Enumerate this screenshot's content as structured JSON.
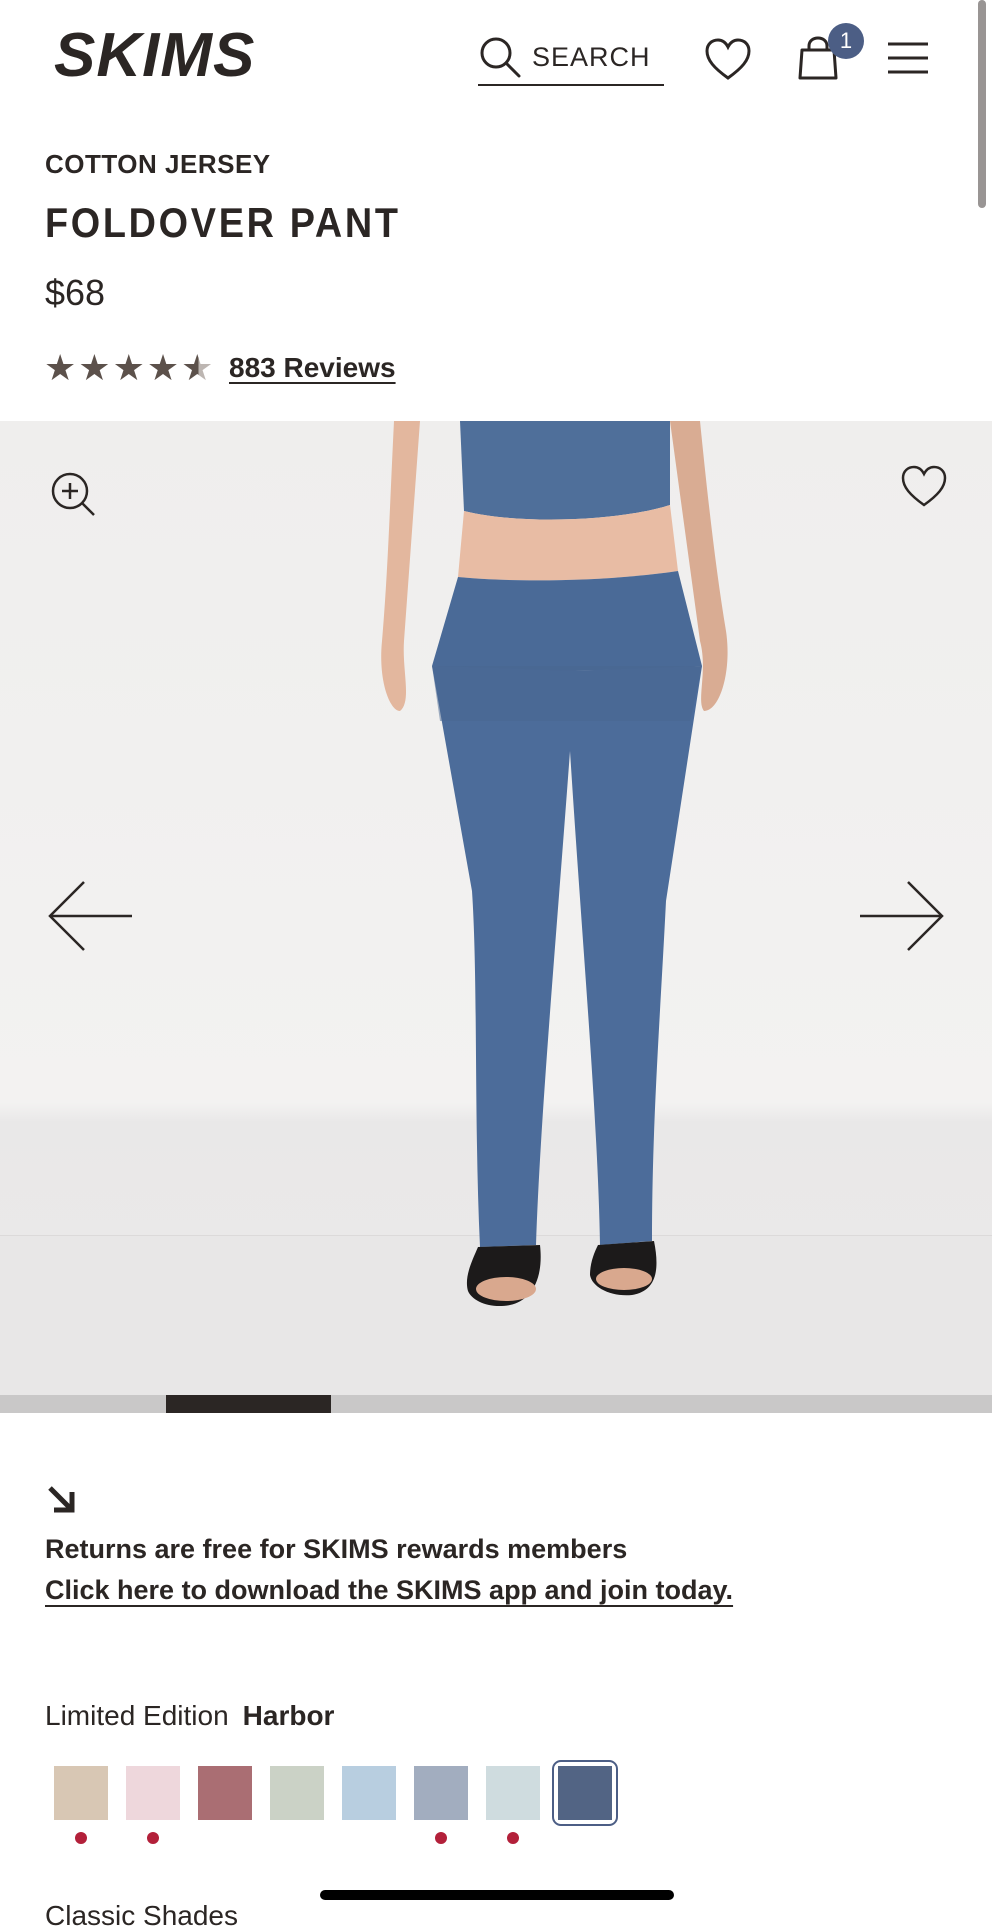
{
  "header": {
    "brand": "SKIMS",
    "search_label": "SEARCH",
    "bag_count": "1"
  },
  "product": {
    "collection": "COTTON JERSEY",
    "title": "FOLDOVER PANT",
    "price": "$68",
    "rating": 4.5,
    "reviews_label": "883 Reviews"
  },
  "gallery": {
    "progress": 0.167,
    "progress_start": 0.167
  },
  "returns": {
    "text": "Returns are free for SKIMS rewards members",
    "link": "Click here to download the SKIMS app and join today."
  },
  "color": {
    "edition_label": "Limited Edition",
    "selected_name": "Harbor",
    "swatches": [
      {
        "color": "#d8c7b4",
        "dot": true
      },
      {
        "color": "#eed7dc",
        "dot": true
      },
      {
        "color": "#aa6e73",
        "dot": false
      },
      {
        "color": "#cbd2c6",
        "dot": false
      },
      {
        "color": "#b8cee0",
        "dot": false
      },
      {
        "color": "#a2adbf",
        "dot": true
      },
      {
        "color": "#cfdcdf",
        "dot": true
      },
      {
        "color": "#526484",
        "dot": false,
        "selected": true
      }
    ]
  },
  "classic_label": "Classic Shades",
  "colors": {
    "accent": "#4c5e85",
    "text": "#2b2624",
    "dot": "#b3203a"
  }
}
